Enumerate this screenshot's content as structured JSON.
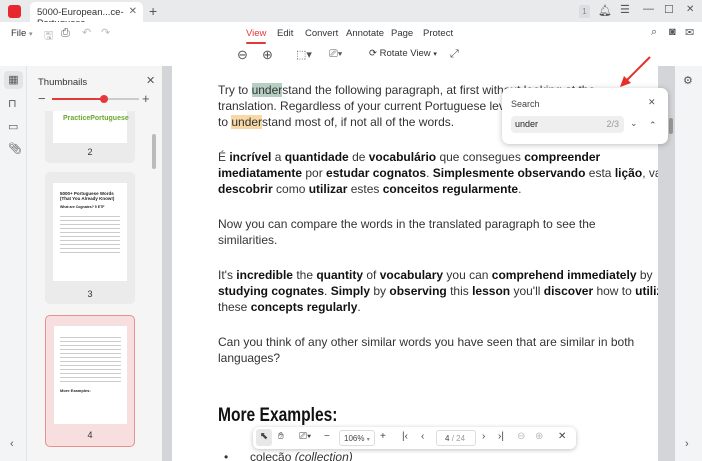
{
  "tab": {
    "title": "5000-European...ce-Portuguese",
    "close": "✕",
    "new": "+"
  },
  "titlebar": {
    "badge": "1"
  },
  "menu": {
    "file": "File",
    "items": [
      "View",
      "Edit",
      "Convert",
      "Annotate",
      "Page",
      "Protect"
    ],
    "active": "View"
  },
  "toolbar": {
    "rotate_view": "Rotate View"
  },
  "thumbnails": {
    "title": "Thumbnails",
    "zoom_level": 0.6,
    "pages": [
      "2",
      "3",
      "4"
    ],
    "selected": "4",
    "page3_title": "5000+ Portuguese Words (That You Already Know!)",
    "page3_subtitle": "What are Cognates? 5 ETF",
    "page2_logo": "PracticePortuguese",
    "page4_heading": "More Examples:"
  },
  "search": {
    "title": "Search",
    "query": "under",
    "count": "2/3"
  },
  "document": {
    "paragraphs": [
      [
        [
          [
            "Try to ",
            0
          ],
          [
            "under",
            3
          ],
          [
            "stand the following paragraph, at first without looking at the",
            0
          ]
        ],
        [
          [
            "translation. Regardless of your current Portuguese level, you should be able",
            0
          ]
        ],
        [
          [
            "to ",
            0
          ],
          [
            "under",
            4
          ],
          [
            "stand most of, if not all of the words.",
            0
          ]
        ]
      ],
      [
        [
          [
            "É ",
            0
          ],
          [
            "incrível",
            1
          ],
          [
            " a ",
            0
          ],
          [
            "quantidade",
            1
          ],
          [
            " de ",
            0
          ],
          [
            "vocabulário",
            1
          ],
          [
            " que consegues ",
            0
          ],
          [
            "compreender",
            1
          ]
        ],
        [
          [
            "imediatamente",
            1
          ],
          [
            " por ",
            0
          ],
          [
            "estudar cognatos",
            1
          ],
          [
            ". ",
            0
          ],
          [
            "Simplesmente observando",
            1
          ],
          [
            " esta ",
            0
          ],
          [
            "lição",
            1
          ],
          [
            ", vais",
            0
          ]
        ],
        [
          [
            "descobrir",
            1
          ],
          [
            " como ",
            0
          ],
          [
            "utilizar",
            1
          ],
          [
            " estes ",
            0
          ],
          [
            "conceitos regularmente",
            1
          ],
          [
            ".",
            0
          ]
        ]
      ],
      [
        [
          [
            "Now you can compare the words in the translated paragraph to see the",
            0
          ]
        ],
        [
          [
            "similarities.",
            0
          ]
        ]
      ],
      [
        [
          [
            "It's ",
            0
          ],
          [
            "incredible",
            1
          ],
          [
            " the ",
            0
          ],
          [
            "quantity",
            1
          ],
          [
            " of ",
            0
          ],
          [
            "vocabulary",
            1
          ],
          [
            " you can ",
            0
          ],
          [
            "comprehend immediately",
            1
          ],
          [
            " by",
            0
          ]
        ],
        [
          [
            "studying cognates",
            1
          ],
          [
            ". ",
            0
          ],
          [
            "Simply",
            1
          ],
          [
            " by ",
            0
          ],
          [
            "observing",
            1
          ],
          [
            " this ",
            0
          ],
          [
            "lesson",
            1
          ],
          [
            " you'll ",
            0
          ],
          [
            "discover",
            1
          ],
          [
            " how to ",
            0
          ],
          [
            "utilize",
            1
          ]
        ],
        [
          [
            "these ",
            0
          ],
          [
            "concepts regularly",
            1
          ],
          [
            ".",
            0
          ]
        ]
      ],
      [
        [
          [
            "Can you think of any other similar words you have seen that are similar in both",
            0
          ]
        ],
        [
          [
            "languages?",
            0
          ]
        ]
      ]
    ],
    "heading": "More Examples:",
    "bullet": "coleção (collection)",
    "bullet_word": "coleção",
    "bullet_trans": "(collection)"
  },
  "bottom_toolbar": {
    "zoom": "106%",
    "page": "4",
    "total": "/ 24"
  },
  "colors": {
    "accent": "#e5383b",
    "highlight_current": "#b6cfc3",
    "highlight_other": "#f8d9a5"
  }
}
